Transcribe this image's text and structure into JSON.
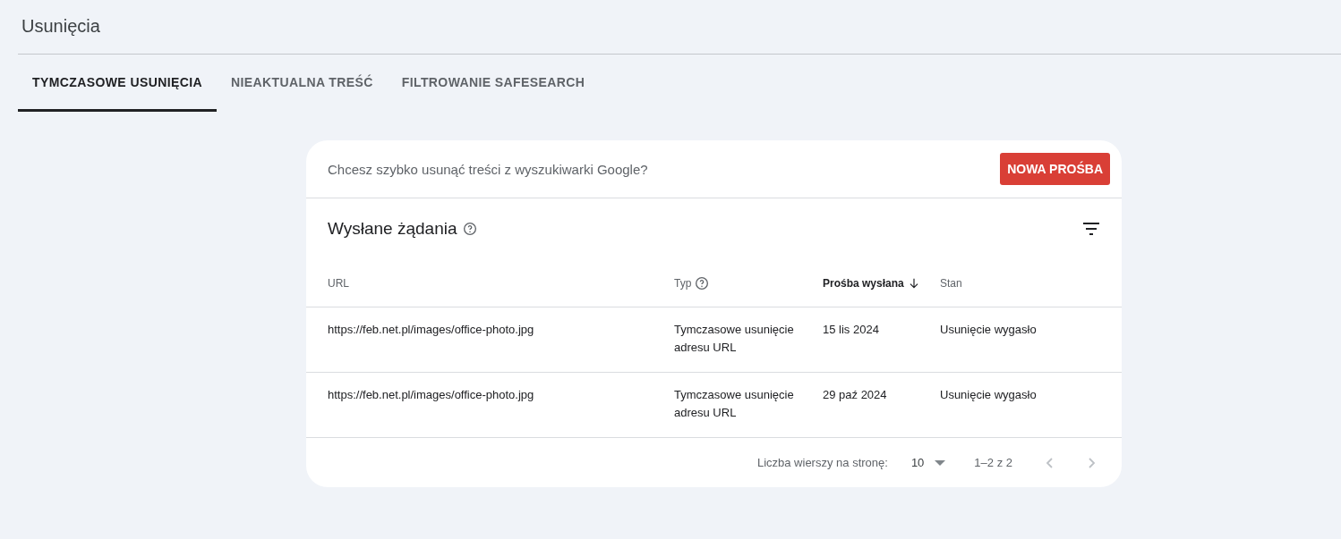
{
  "page": {
    "title": "Usunięcia"
  },
  "tabs": [
    {
      "label": "TYMCZASOWE USUNIĘCIA",
      "selected": true
    },
    {
      "label": "NIEAKTUALNA TREŚĆ",
      "selected": false
    },
    {
      "label": "FILTROWANIE SAFESEARCH",
      "selected": false
    }
  ],
  "banner": {
    "text": "Chcesz szybko usunąć treści z wyszukiwarki Google?",
    "button": "NOWA PROŚBA"
  },
  "table": {
    "title": "Wysłane żądania",
    "columns": [
      {
        "label": "URL",
        "sorted": false,
        "help": false
      },
      {
        "label": "Typ",
        "sorted": false,
        "help": true
      },
      {
        "label": "Prośba wysłana",
        "sorted": true,
        "help": false
      },
      {
        "label": "Stan",
        "sorted": false,
        "help": false
      }
    ],
    "rows": [
      [
        "https://feb.net.pl/images/office-photo.jpg",
        "Tymczasowe usunięcie adresu URL",
        "15 lis 2024",
        "Usunięcie wygasło"
      ],
      [
        "https://feb.net.pl/images/office-photo.jpg",
        "Tymczasowe usunięcie adresu URL",
        "29 paź 2024",
        "Usunięcie wygasło"
      ]
    ]
  },
  "pagination": {
    "rows_label": "Liczba wierszy na stronę:",
    "rows_value": "10",
    "range": "1–2 z 2"
  }
}
